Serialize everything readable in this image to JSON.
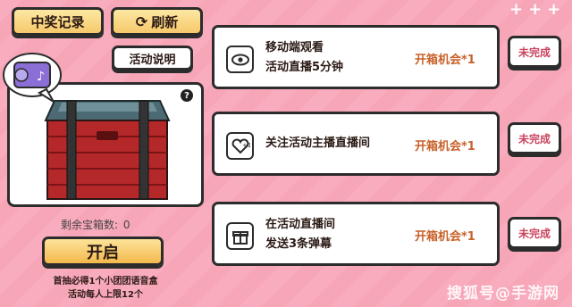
{
  "header": {
    "win_record_label": "中奖记录",
    "refresh_label": "刷新",
    "rules_label": "活动说明"
  },
  "box_panel": {
    "help_label": "?",
    "remaining_label": "剩余宝箱数:",
    "remaining_count": "0"
  },
  "open_button_label": "开启",
  "notes": {
    "line1": "首抽必得1个小团团语音盒",
    "line2": "活动每人上限12个"
  },
  "tasks": [
    {
      "icon": "eye-icon",
      "title_line1": "移动端观看",
      "title_line2": "活动直播5分钟",
      "reward": "开箱机会*1",
      "status": "未完成"
    },
    {
      "icon": "heart-plus-icon",
      "title_line1": "关注活动主播直播间",
      "title_line2": "",
      "reward": "开箱机会*1",
      "status": "未完成"
    },
    {
      "icon": "gift-icon",
      "title_line1": "在活动直播间",
      "title_line2": "发送3条弹幕",
      "reward": "开箱机会*1",
      "status": "未完成"
    }
  ],
  "watermark": "搜狐号@手游网",
  "colors": {
    "background": "#f7a6b8",
    "button_yellow": "#f6c86a",
    "reward_text": "#c9612a",
    "status_text": "#c9455f",
    "crate_red": "#b5282a"
  }
}
